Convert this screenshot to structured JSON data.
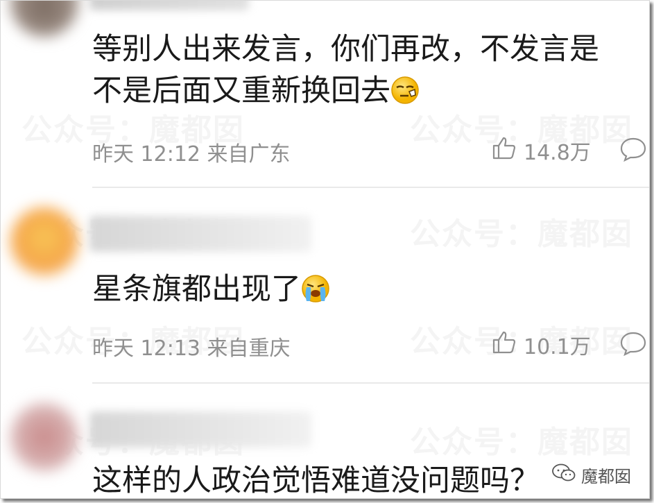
{
  "watermark_text": "公众号：魔都囡",
  "comments": [
    {
      "text_line1": "等别人出来发言，你们再改，不发言是",
      "text_line2": "不是后面又重新换回去",
      "emoji": "smirk-emoji",
      "time": "昨天 12:12",
      "location": "来自广东",
      "likes": "14.8万"
    },
    {
      "text": "星条旗都出现了",
      "emoji": "crying-emoji",
      "time": "昨天 12:13",
      "location": "来自重庆",
      "likes": "10.1万"
    },
    {
      "text": "这样的人政治觉悟难道没问题吗？"
    }
  ],
  "badge": {
    "label": "魔都囡"
  },
  "colors": {
    "text": "#1a1a1a",
    "meta": "#8f8f8f",
    "divider": "#e9e9e9"
  }
}
